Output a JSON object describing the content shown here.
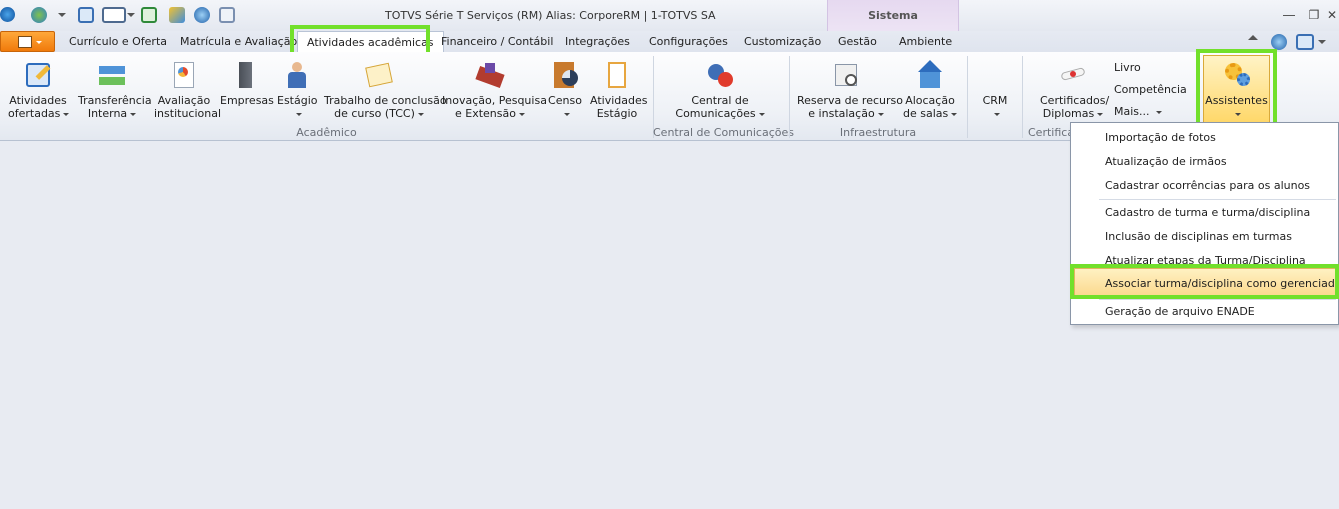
{
  "window": {
    "title": "TOTVS Série T Serviços (RM) Alias: CorporeRM | 1-TOTVS SA",
    "context_tab": "Sistema"
  },
  "tabs": [
    {
      "label": "Currículo e Oferta"
    },
    {
      "label": "Matrícula e Avaliação"
    },
    {
      "label": "Atividades acadêmicas",
      "active": true
    },
    {
      "label": "Financeiro / Contábil"
    },
    {
      "label": "Integrações"
    },
    {
      "label": "Configurações"
    },
    {
      "label": "Customização"
    },
    {
      "label": "Gestão"
    },
    {
      "label": "Ambiente"
    }
  ],
  "ribbon": {
    "groups": [
      {
        "label": "Acadêmico"
      },
      {
        "label": "Central de Comunicações"
      },
      {
        "label": "Infraestrutura"
      },
      {
        "label": "Certifica"
      }
    ],
    "buttons": {
      "atividades_ofertadas": {
        "line1": "Atividades",
        "line2": "ofertadas"
      },
      "transferencia_interna": {
        "line1": "Transferência",
        "line2": "Interna"
      },
      "avaliacao_institucional": {
        "line1": "Avaliação",
        "line2": "institucional"
      },
      "empresas": {
        "line1": "Empresas"
      },
      "estagio": {
        "line1": "Estágio"
      },
      "tcc": {
        "line1": "Trabalho de conclusão",
        "line2": "de curso (TCC)"
      },
      "inovacao": {
        "line1": "Inovação, Pesquisa",
        "line2": "e Extensão"
      },
      "censo": {
        "line1": "Censo"
      },
      "atividades_estagio": {
        "line1": "Atividades",
        "line2": "Estágio"
      },
      "central_comunicacoes": {
        "line1": "Central de",
        "line2": "Comunicações"
      },
      "reserva_recurso": {
        "line1": "Reserva de recurso",
        "line2": "e instalação"
      },
      "alocacao_salas": {
        "line1": "Alocação",
        "line2": "de salas"
      },
      "crm": {
        "line1": "CRM"
      },
      "certificados": {
        "line1": "Certificados/",
        "line2": "Diplomas"
      },
      "assistentes": {
        "line1": "Assistentes"
      }
    },
    "small_items": {
      "livro": "Livro",
      "competencia": "Competência",
      "mais": "Mais..."
    }
  },
  "assistentes_menu": {
    "items": [
      {
        "label": "Importação de fotos"
      },
      {
        "label": "Atualização de irmãos"
      },
      {
        "label": "Cadastrar ocorrências para os alunos"
      },
      {
        "label": "Cadastro de turma e turma/disciplina"
      },
      {
        "label": "Inclusão de disciplinas em turmas"
      },
      {
        "label": "Atualizar etapas da Turma/Disciplina"
      },
      {
        "label": "Associar turma/disciplina como gerenciada",
        "selected": true
      },
      {
        "label": "Geração de arquivo ENADE"
      }
    ]
  },
  "colors": {
    "highlight": "#72e02b",
    "app_button": "#f07a0b",
    "selected_item": "#fbd88c"
  }
}
